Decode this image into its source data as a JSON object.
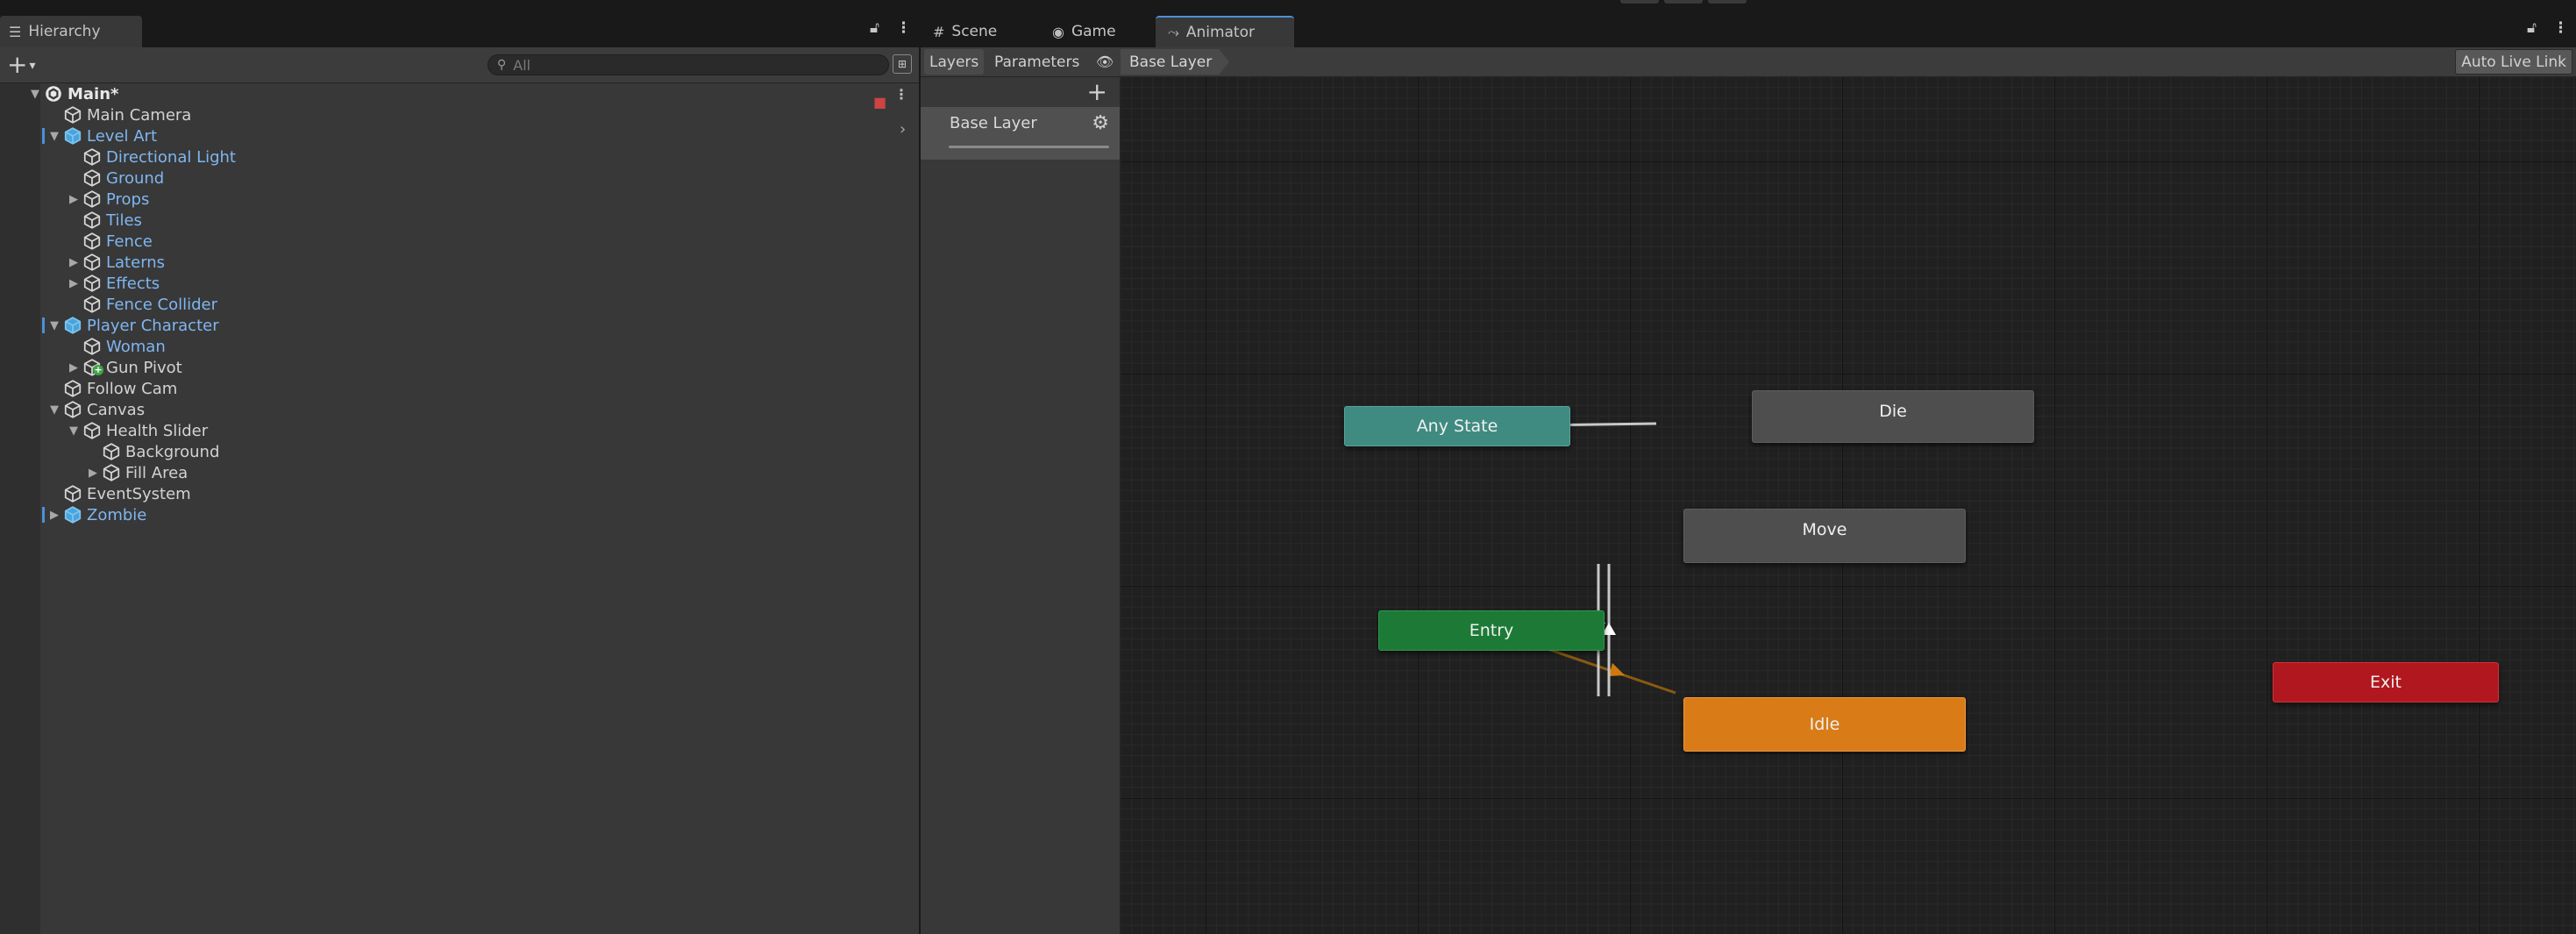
{
  "hierarchy": {
    "tab_label": "Hierarchy",
    "search_placeholder": "All",
    "items": [
      {
        "label": "Main*",
        "kind": "scene",
        "depth": 0,
        "expanded": true
      },
      {
        "label": "Main Camera",
        "kind": "object",
        "depth": 1
      },
      {
        "label": "Level Art",
        "kind": "prefab-root",
        "depth": 1,
        "expanded": true
      },
      {
        "label": "Directional Light",
        "kind": "prefab",
        "depth": 2
      },
      {
        "label": "Ground",
        "kind": "prefab",
        "depth": 2
      },
      {
        "label": "Props",
        "kind": "prefab",
        "depth": 2,
        "expanded": false
      },
      {
        "label": "Tiles",
        "kind": "prefab",
        "depth": 2
      },
      {
        "label": "Fence",
        "kind": "prefab",
        "depth": 2
      },
      {
        "label": "Laterns",
        "kind": "prefab",
        "depth": 2,
        "expanded": false
      },
      {
        "label": "Effects",
        "kind": "prefab",
        "depth": 2,
        "expanded": false
      },
      {
        "label": "Fence Collider",
        "kind": "prefab",
        "depth": 2
      },
      {
        "label": "Player Character",
        "kind": "prefab-root",
        "depth": 1,
        "expanded": true
      },
      {
        "label": "Woman",
        "kind": "prefab",
        "depth": 2
      },
      {
        "label": "Gun Pivot",
        "kind": "object-added",
        "depth": 2,
        "expanded": false
      },
      {
        "label": "Follow Cam",
        "kind": "object",
        "depth": 1
      },
      {
        "label": "Canvas",
        "kind": "object",
        "depth": 1,
        "expanded": true
      },
      {
        "label": "Health Slider",
        "kind": "object",
        "depth": 2,
        "expanded": true
      },
      {
        "label": "Background",
        "kind": "object",
        "depth": 3
      },
      {
        "label": "Fill Area",
        "kind": "object",
        "depth": 3,
        "expanded": false
      },
      {
        "label": "EventSystem",
        "kind": "object",
        "depth": 1
      },
      {
        "label": "Zombie",
        "kind": "prefab-root",
        "depth": 1,
        "expanded": false
      }
    ]
  },
  "tabs": {
    "scene": "Scene",
    "game": "Game",
    "animator": "Animator"
  },
  "animator": {
    "toolbar": {
      "layers": "Layers",
      "parameters": "Parameters",
      "breadcrumb": "Base Layer",
      "auto_live_link": "Auto Live Link"
    },
    "layers": [
      {
        "name": "Base Layer"
      }
    ],
    "states": {
      "any_state": "Any State",
      "die": "Die",
      "move": "Move",
      "entry": "Entry",
      "idle": "Idle",
      "exit": "Exit"
    }
  },
  "colors": {
    "any_state": "#3f8a81",
    "entry": "#1c7a36",
    "default_state": "#d97b16",
    "exit": "#b1171e",
    "state": "#4e4e4e",
    "prefab_text": "#7fb6f0"
  }
}
